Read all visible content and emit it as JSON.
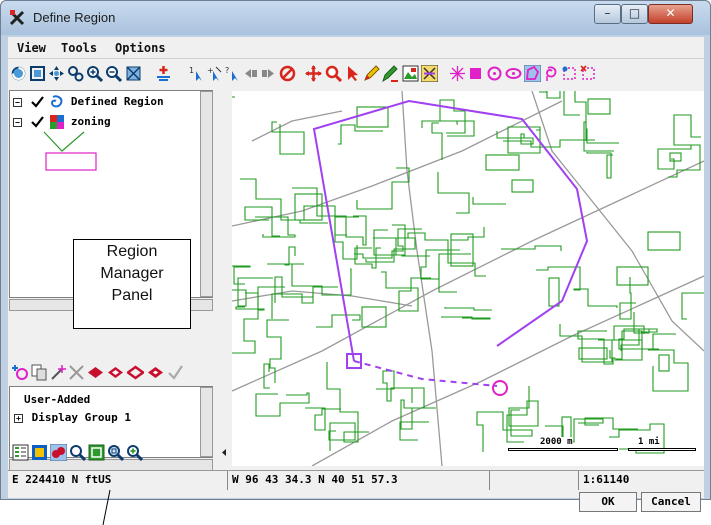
{
  "window": {
    "title": "Define Region",
    "controls": {
      "minimize": "–",
      "maximize": "□",
      "close": "✕"
    }
  },
  "menubar": {
    "items": [
      "View",
      "Tools",
      "Options"
    ]
  },
  "toolbar": {
    "icons": [
      "redraw-icon",
      "full-view-icon",
      "pan-icon",
      "zoom-box-icon",
      "zoom-in-icon",
      "zoom-out-icon",
      "zoom-extents-icon",
      "add-layer-icon",
      "select-icon",
      "select-add-icon",
      "query-icon",
      "previous-icon",
      "next-icon",
      "stop-icon",
      "move-icon",
      "magnify-icon",
      "pointer-icon",
      "pen-icon",
      "draw-icon",
      "image-icon",
      "region-icon",
      "sparkle-icon",
      "rectangle-icon",
      "circle-icon",
      "ellipse-icon",
      "polygon-icon",
      "lasso-icon",
      "point-region-icon",
      "erase-region-icon"
    ]
  },
  "tree": {
    "items": [
      {
        "expander": "−",
        "label": "Defined Region"
      },
      {
        "expander": "−",
        "label": "zoning"
      }
    ]
  },
  "callout": {
    "line1": "Region",
    "line2": "Manager",
    "line3": "Panel"
  },
  "region_groups": {
    "items": [
      {
        "label": "User-Added"
      },
      {
        "expander": "+",
        "label": "Display Group 1"
      }
    ]
  },
  "map": {
    "scalebar_left": "2000 m",
    "scalebar_right": "1 mi",
    "colors": {
      "parcels": "#1f9a1f",
      "roads": "#9a9a9a",
      "region": "#a040f0"
    }
  },
  "status": {
    "coord_left": "E  224410 N ftUS",
    "coord_geo": "W 96 43 34.3  N 40 51 57.3",
    "scale": "1:61140"
  },
  "buttons": {
    "ok": "OK",
    "cancel": "Cancel"
  }
}
